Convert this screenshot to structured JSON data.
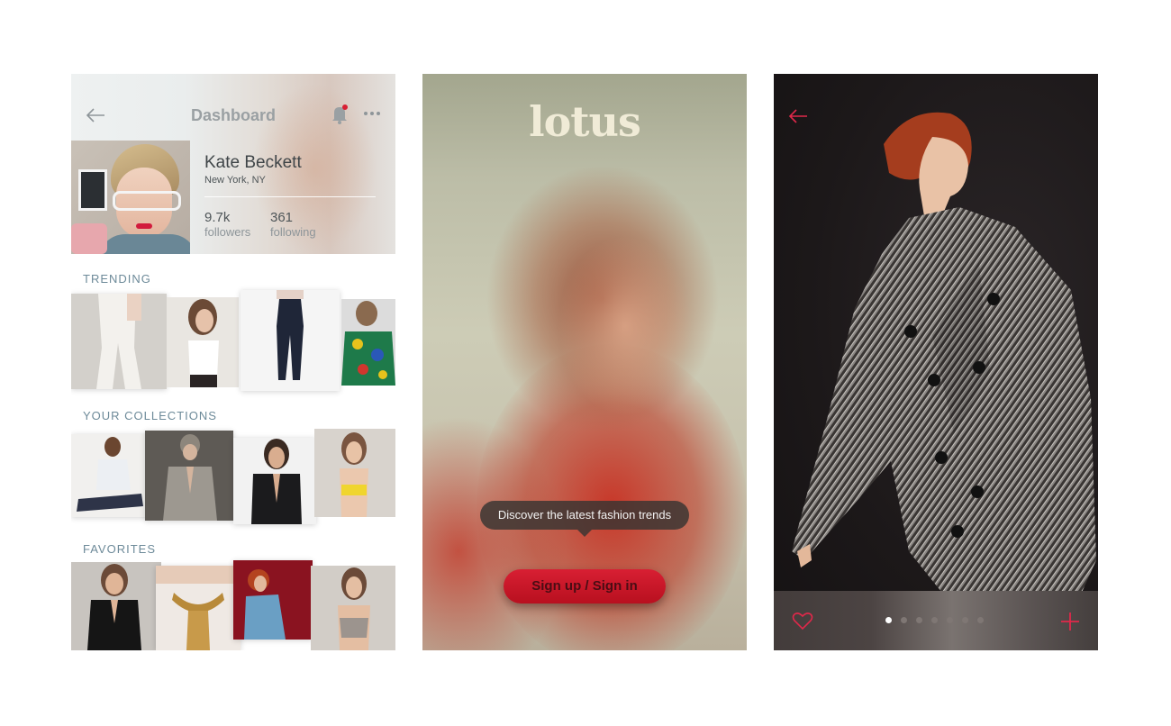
{
  "dashboard": {
    "title": "Dashboard",
    "profile": {
      "name": "Kate Beckett",
      "location": "New York, NY",
      "followers_count": "9.7k",
      "followers_label": "followers",
      "following_count": "361",
      "following_label": "following"
    },
    "sections": {
      "trending": "TRENDING",
      "collections": "YOUR COLLECTIONS",
      "favorites": "FAVORITES"
    },
    "icons": [
      "back-arrow-icon",
      "bell-icon",
      "more-icon"
    ]
  },
  "splash": {
    "logo": "lotus",
    "tooltip": "Discover the latest fashion trends",
    "signin_button": "Sign up / Sign in"
  },
  "product": {
    "carousel": {
      "count": 7,
      "active_index": 0
    },
    "icons": [
      "back-arrow-icon",
      "heart-icon",
      "plus-icon"
    ]
  },
  "colors": {
    "accent": "#d81f33",
    "section_title": "#6d8a99",
    "logo": "#f0ebd7"
  }
}
